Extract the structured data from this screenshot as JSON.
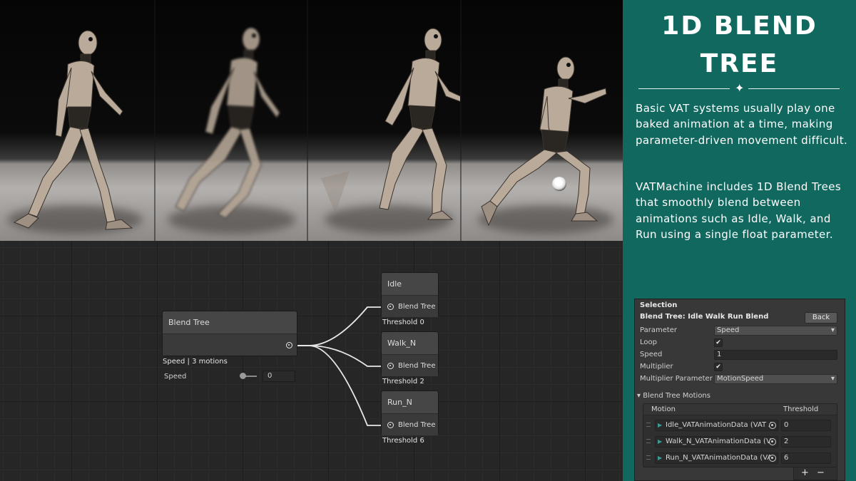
{
  "panel": {
    "title_line1": "1D BLEND",
    "title_line2": "TREE",
    "para1": "Basic VAT systems usually play one baked animation at a time, making parameter-driven movement difficult.",
    "para2": "VATMachine includes 1D Blend Trees that smoothly blend between animations such as Idle, Walk, and Run using a single float parameter.",
    "bg_color": "#11685f"
  },
  "graph": {
    "blend_node": {
      "title": "Blend Tree",
      "subtitle": "Speed | 3 motions",
      "param_label": "Speed",
      "param_value": "0"
    },
    "motions": [
      {
        "name": "Idle",
        "type_label": "Blend Tree",
        "threshold_label": "Threshold 0"
      },
      {
        "name": "Walk_N",
        "type_label": "Blend Tree",
        "threshold_label": "Threshold 2"
      },
      {
        "name": "Run_N",
        "type_label": "Blend Tree",
        "threshold_label": "Threshold 6"
      }
    ]
  },
  "inspector": {
    "header": "Selection",
    "name": "Blend Tree: Idle Walk Run Blend",
    "back_label": "Back",
    "parameter_label": "Parameter",
    "parameter_value": "Speed",
    "loop_label": "Loop",
    "loop_checked": "✔",
    "speed_label": "Speed",
    "speed_value": "1",
    "multiplier_label": "Multiplier",
    "multiplier_checked": "✔",
    "multiplier_param_label": "Multiplier Parameter",
    "multiplier_param_value": "MotionSpeed",
    "foldout_label": "▾ Blend Tree Motions",
    "col_motion": "Motion",
    "col_threshold": "Threshold",
    "rows": [
      {
        "motion": "Idle_VATAnimationData (VAT A",
        "threshold": "0"
      },
      {
        "motion": "Walk_N_VATAnimationData (VA",
        "threshold": "2"
      },
      {
        "motion": "Run_N_VATAnimationData (VA",
        "threshold": "6"
      }
    ],
    "add_label": "+",
    "remove_label": "−"
  }
}
